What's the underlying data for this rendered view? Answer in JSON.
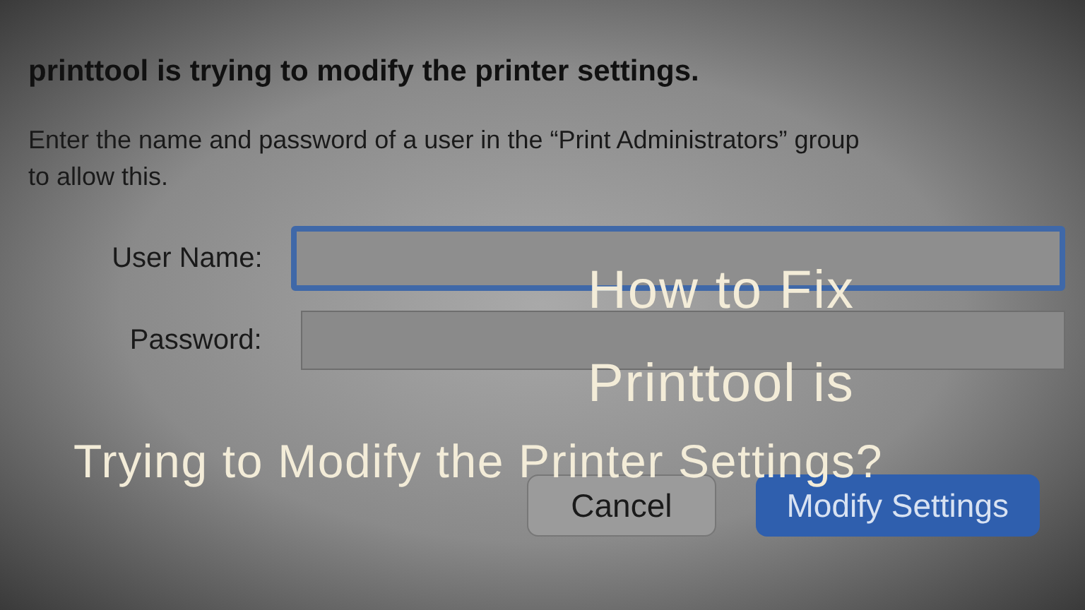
{
  "dialog": {
    "heading": "printtool is trying to modify the printer settings.",
    "message": "Enter the name and password of a user in the “Print Administrators” group to allow this.",
    "fields": [
      {
        "label": "User Name:",
        "focused": true
      },
      {
        "label": "Password:",
        "focused": false
      }
    ],
    "buttons": [
      {
        "label": "Cancel",
        "default": false
      },
      {
        "label": "Modify Settings",
        "default": true
      }
    ]
  },
  "overlay_title": [
    "How to Fix",
    "Printtool is",
    "Trying to Modify the Printer Settings?"
  ]
}
